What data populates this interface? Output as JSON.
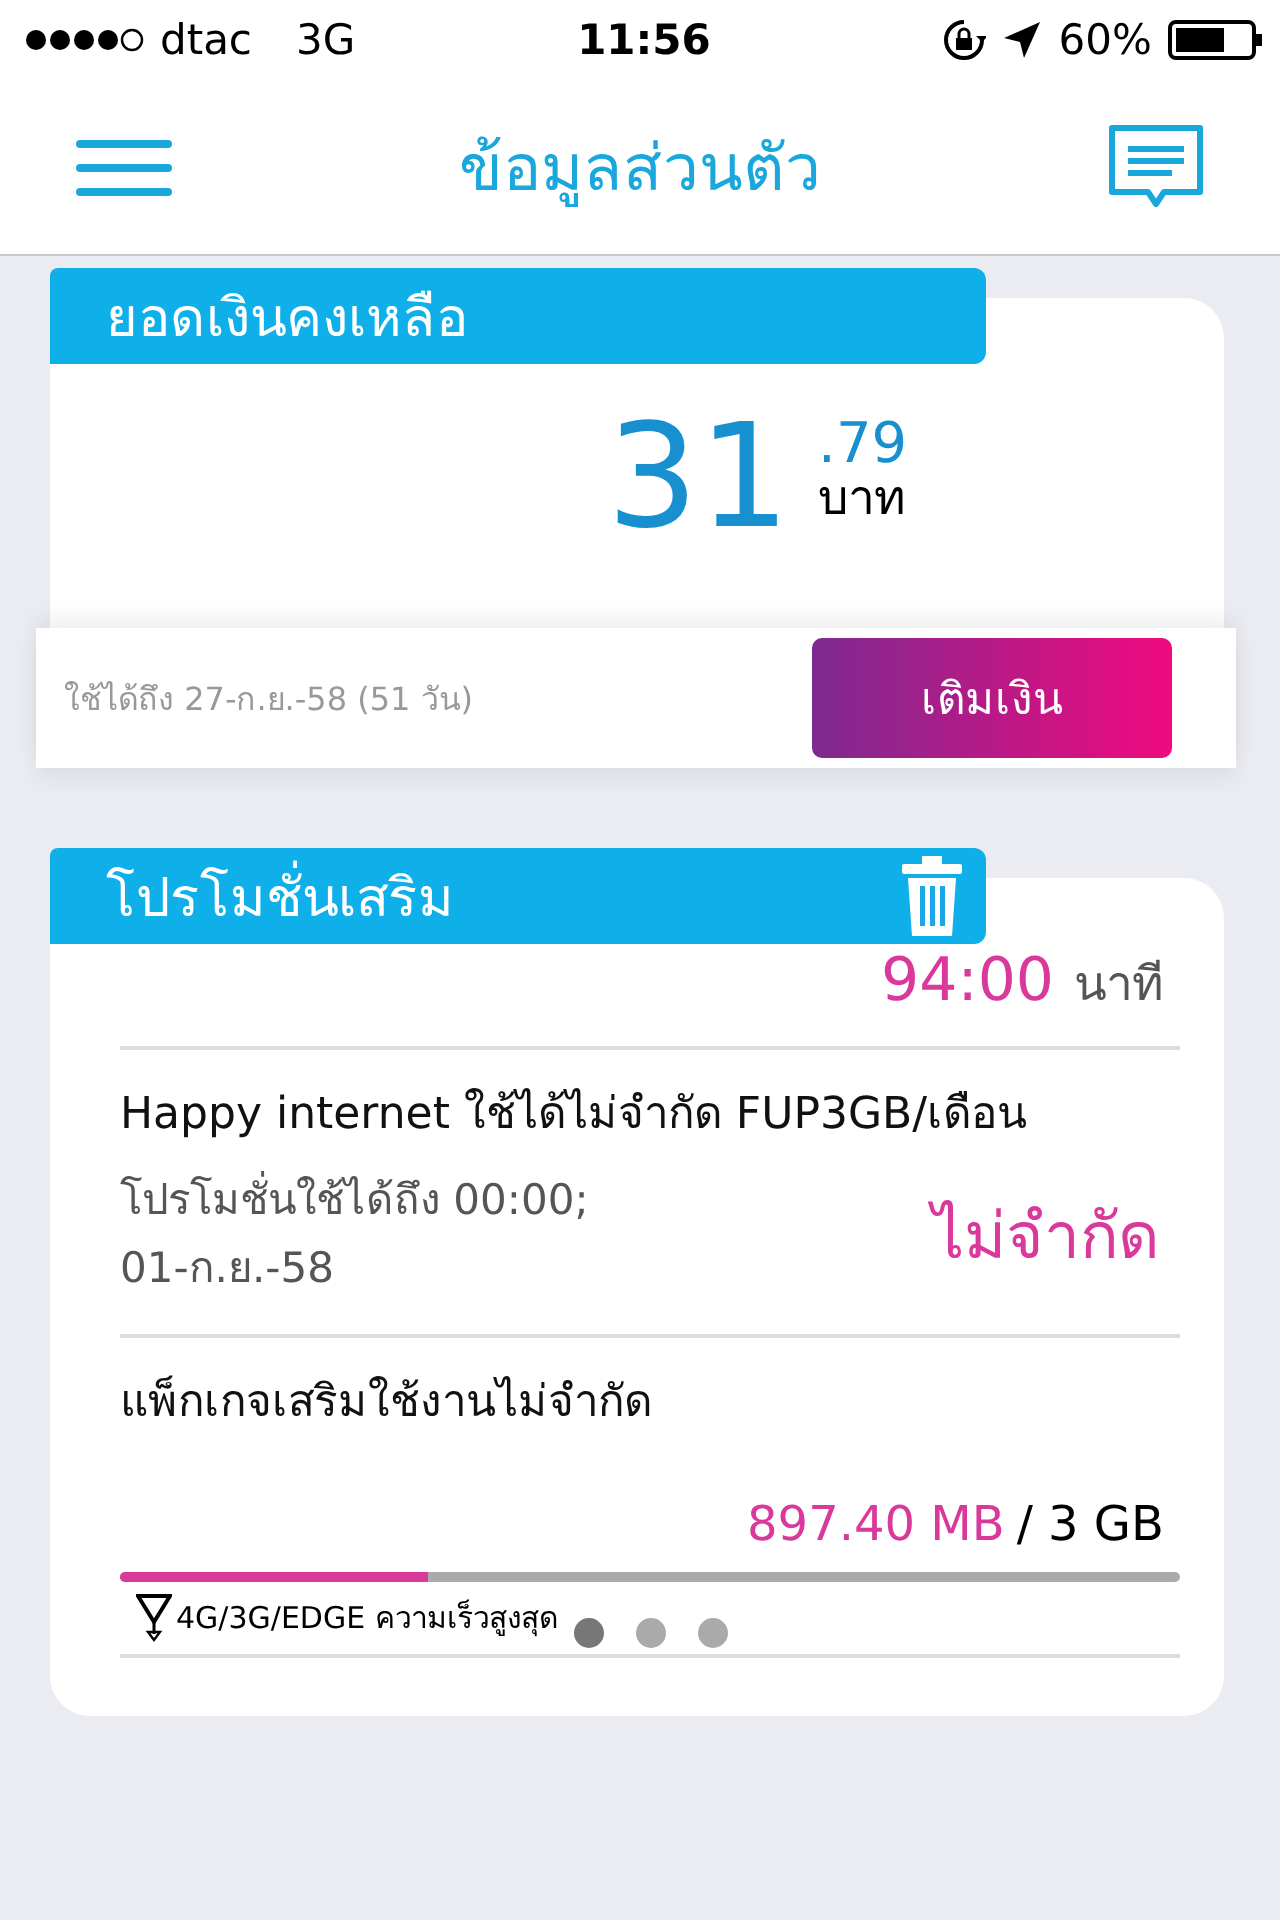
{
  "status_bar": {
    "carrier": "dtac",
    "network": "3G",
    "time": "11:56",
    "battery": "60%"
  },
  "nav": {
    "title": "ข้อมูลส่วนตัว"
  },
  "balance": {
    "title": "ยอดเงินคงเหลือ",
    "amount": "31",
    "decimal": ".79",
    "unit": "บาท",
    "validity": "ใช้ได้ถึง 27-ก.ย.-58 (51 วัน)",
    "button": "เติมเงิน"
  },
  "promotions": {
    "title": "โปรโมชั่นเสริม",
    "items": [
      {
        "kind": "minutes",
        "value": "94:00",
        "unit": "นาที"
      },
      {
        "kind": "unlimited",
        "name": "Happy internet ใช้ได้ไม่จำกัด FUP3GB/เดือน",
        "validity": "โปรโมชั่นใช้ได้ถึง 00:00;\n01-ก.ย.-58",
        "value": "ไม่จำกัด"
      },
      {
        "kind": "data",
        "name": "แพ็กเกจเสริมใช้งานไม่จำกัด",
        "used": "897.40 MB",
        "total": "/ 3 GB",
        "level": 0.29,
        "note": "4G/3G/EDGE ความเร็วสูงสุด"
      }
    ],
    "pages": [
      {
        "selected": true
      },
      {
        "selected": false
      },
      {
        "selected": false
      }
    ]
  }
}
